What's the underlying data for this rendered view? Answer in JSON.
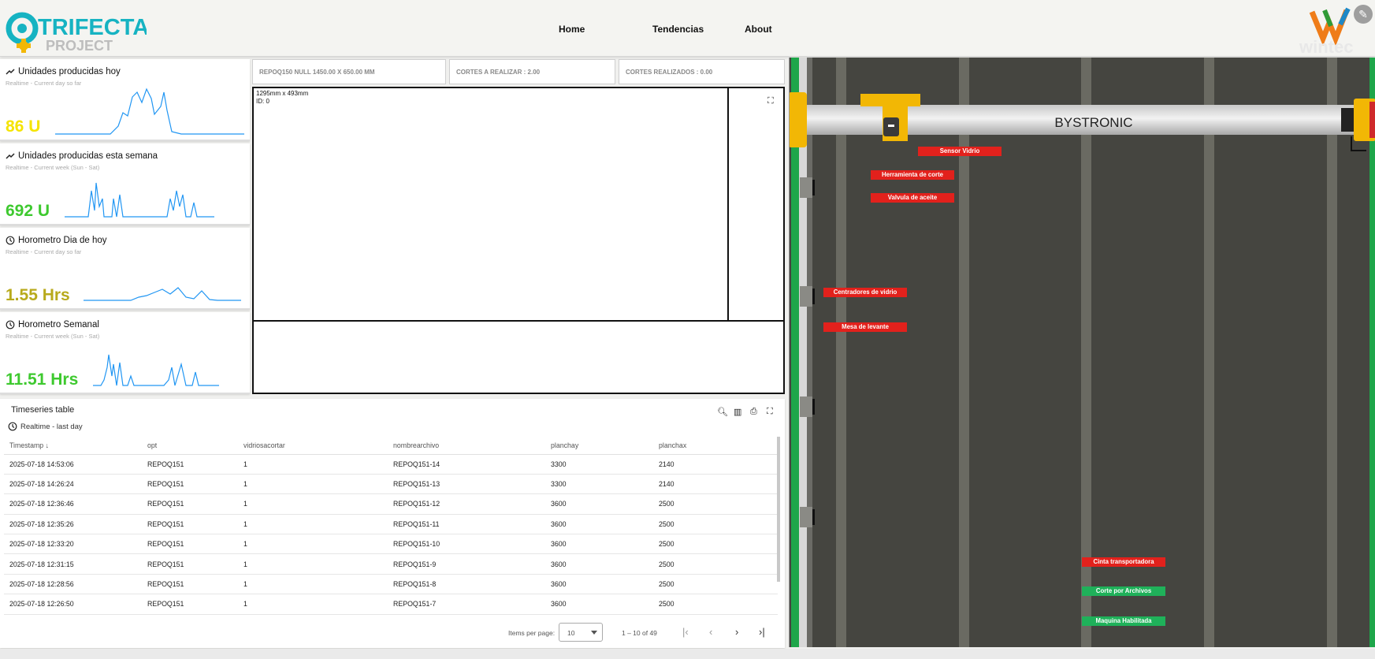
{
  "header": {
    "logo_main": "TRIFECTA",
    "logo_sub": "PROJECT",
    "nav": [
      "Home",
      "Tendencias",
      "About"
    ],
    "brand_right": "wintec"
  },
  "cards": [
    {
      "title": "Unidades producidas hoy",
      "subtitle": "Realtime - Current day so far",
      "value": "86 U",
      "value_color": "#f5e400",
      "icon": "trend-icon"
    },
    {
      "title": "Unidades producidas esta semana",
      "subtitle": "Realtime - Current week (Sun - Sat)",
      "value": "692 U",
      "value_color": "#3ec92f",
      "icon": "trend-icon"
    },
    {
      "title": "Horometro Dia de hoy",
      "subtitle": "Realtime - Current day so far",
      "value": "1.55 Hrs",
      "value_color": "#b8aa1c",
      "icon": "clock-icon"
    },
    {
      "title": "Horometro Semanal",
      "subtitle": "Realtime - Current week (Sun - Sat)",
      "value": "11.51 Hrs",
      "value_color": "#3ec92f",
      "icon": "clock-icon"
    }
  ],
  "info": {
    "file": "REPOQ150 NULL 1450.00 X 650.00 MM",
    "cortes_realizar": "CORTES A REALIZAR : 2.00",
    "cortes_realizados": "CORTES REALIZADOS : 0.00"
  },
  "viewer": {
    "dimensions": "1295mm x 493mm",
    "id": "ID: 0"
  },
  "table": {
    "title": "Timeseries table",
    "subtitle": "Realtime - last day",
    "columns": [
      "Timestamp",
      "opt",
      "vidriosacortar",
      "nombrearchivo",
      "planchay",
      "planchax"
    ],
    "rows": [
      [
        "2025-07-18 14:53:06",
        "REPOQ151",
        "1",
        "REPOQ151-14",
        "3300",
        "2140"
      ],
      [
        "2025-07-18 14:26:24",
        "REPOQ151",
        "1",
        "REPOQ151-13",
        "3300",
        "2140"
      ],
      [
        "2025-07-18 12:36:46",
        "REPOQ151",
        "1",
        "REPOQ151-12",
        "3600",
        "2500"
      ],
      [
        "2025-07-18 12:35:26",
        "REPOQ151",
        "1",
        "REPOQ151-11",
        "3600",
        "2500"
      ],
      [
        "2025-07-18 12:33:20",
        "REPOQ151",
        "1",
        "REPOQ151-10",
        "3600",
        "2500"
      ],
      [
        "2025-07-18 12:31:15",
        "REPOQ151",
        "1",
        "REPOQ151-9",
        "3600",
        "2500"
      ],
      [
        "2025-07-18 12:28:56",
        "REPOQ151",
        "1",
        "REPOQ151-8",
        "3600",
        "2500"
      ],
      [
        "2025-07-18 12:26:50",
        "REPOQ151",
        "1",
        "REPOQ151-7",
        "3600",
        "2500"
      ]
    ],
    "pager": {
      "items_label": "Items per page:",
      "page_size": "10",
      "range": "1 – 10 of 49"
    }
  },
  "machine": {
    "brand": "BYSTRONIC",
    "labels": {
      "sensor": "Sensor Vidrio",
      "herramienta": "Herramienta de corte",
      "valvula": "Valvula de aceite",
      "centradores": "Centradores de vidrio",
      "mesa": "Mesa de levante",
      "cinta": "Cinta transportadora",
      "corte": "Corte por Archivos",
      "maquina": "Maquina Habilitada"
    },
    "colors": {
      "alarm": "#e2211c",
      "ok": "#1fb15a"
    }
  }
}
